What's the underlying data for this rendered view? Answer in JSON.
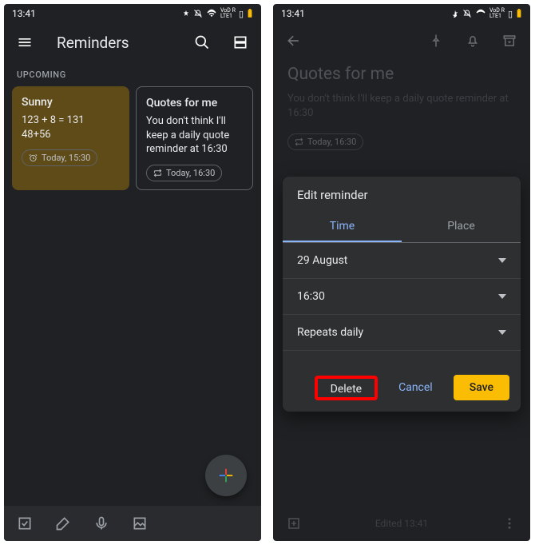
{
  "status": {
    "time": "13:41",
    "indicators": "✱ 🔕 📶 LTE1 🔋"
  },
  "left": {
    "appTitle": "Reminders",
    "sectionLabel": "UPCOMING",
    "cards": [
      {
        "title": "Sunny",
        "body": "123 + 8 = 131\n48+56",
        "chip": "Today, 15:30",
        "chipIcon": "alarm"
      },
      {
        "title": "Quotes for me",
        "body": "You don't think I'll keep a daily quote reminder at 16:30",
        "chip": "Today, 16:30",
        "chipIcon": "repeat"
      }
    ]
  },
  "right": {
    "noteTitle": "Quotes for me",
    "noteBody": "You don't think I'll keep a daily quote reminder at 16:30",
    "noteChip": "Today, 16:30",
    "sheet": {
      "title": "Edit reminder",
      "tabs": {
        "time": "Time",
        "place": "Place"
      },
      "fields": {
        "date": "29 August",
        "time": "16:30",
        "repeat": "Repeats daily"
      },
      "buttons": {
        "delete": "Delete",
        "cancel": "Cancel",
        "save": "Save"
      }
    },
    "edited": "Edited 13:41"
  }
}
